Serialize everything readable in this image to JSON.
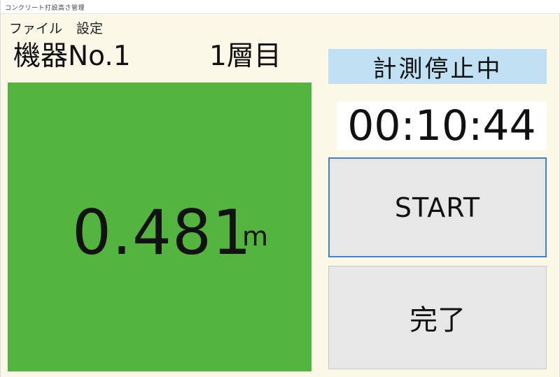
{
  "window": {
    "title": "コンクリート打設高さ管理"
  },
  "menu": {
    "file": "ファイル",
    "settings": "設定"
  },
  "header": {
    "device": "機器No.1",
    "layer": "1層目"
  },
  "measurement": {
    "value": "0.481",
    "unit": "m",
    "panel_color": "#53b53e"
  },
  "status": {
    "text": "計測停止中",
    "badge_color": "#bfe1f3"
  },
  "timer": {
    "elapsed": "00:10:44"
  },
  "buttons": {
    "start": "START",
    "complete": "完了"
  }
}
